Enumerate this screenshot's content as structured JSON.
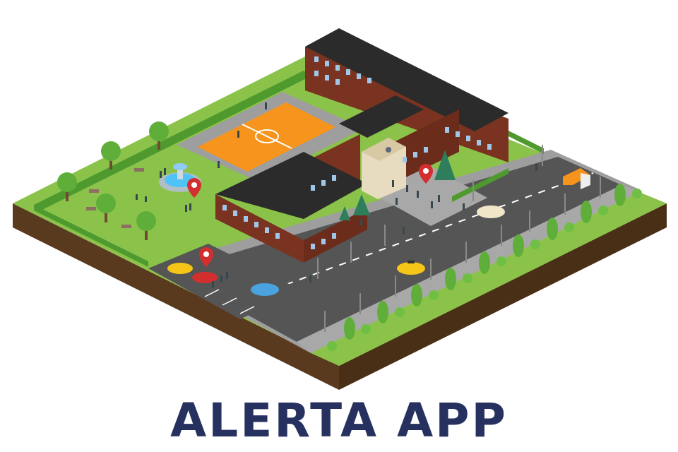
{
  "title": {
    "text": "ALERTA APP",
    "color": "#27315f"
  },
  "scene": {
    "description_icons": [
      "school-building-icon",
      "basketball-court-icon",
      "fountain-icon",
      "location-pin-icon",
      "car-icon",
      "taxi-icon",
      "truck-icon",
      "tree-icon",
      "street-lamp-icon",
      "person-icon"
    ],
    "colors": {
      "grass": "#8bc34a",
      "grass_dark": "#6fa83a",
      "hedge": "#4e9a2e",
      "soil": "#5a3a1f",
      "soil_dark": "#3d2712",
      "road": "#5a5a5a",
      "sidewalk": "#9e9e9e",
      "court": "#f7941d",
      "brick": "#7a3320",
      "roof": "#2b2b2b",
      "pin": "#d32f2f"
    }
  }
}
